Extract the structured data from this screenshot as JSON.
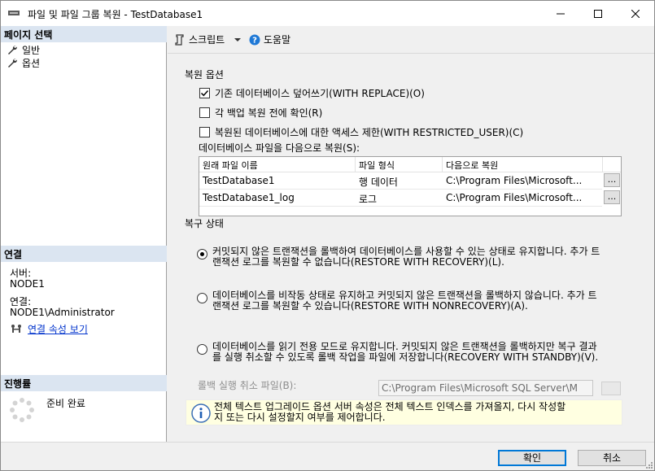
{
  "window": {
    "title": "파일 및 파일 그룹 복원 - TestDatabase1"
  },
  "left_pane": {
    "page_select_header": "페이지 선택",
    "pages": [
      {
        "label": "일반",
        "icon": "wrench-icon"
      },
      {
        "label": "옵션",
        "icon": "wrench-icon"
      }
    ],
    "connection_header": "연결",
    "server_label": "서버:",
    "server_value": "NODE1",
    "connection_label": "연결:",
    "connection_value": "NODE1\\Administrator",
    "view_connection_link": "연결 속성 보기",
    "progress_header": "진행률",
    "progress_status": "준비 완료"
  },
  "toolbar": {
    "script_label": "스크립트",
    "help_label": "도움말"
  },
  "restore_options": {
    "title": "복원 옵션",
    "options": [
      {
        "label": "기존 데이터베이스 덮어쓰기(WITH REPLACE)(O)",
        "checked": true
      },
      {
        "label": "각 백업 복원 전에 확인(R)",
        "checked": false
      },
      {
        "label": "복원된 데이터베이스에 대한 액세스 제한(WITH RESTRICTED_USER)(C)",
        "checked": false
      }
    ],
    "restore_files_as_label": "데이터베이스 파일을 다음으로 복원(S):",
    "table": {
      "headers": [
        "원래 파일 이름",
        "파일 형식",
        "다음으로 복원"
      ],
      "rows": [
        {
          "original": "TestDatabase1",
          "type": "행 데이터",
          "restore_as": "C:\\Program Files\\Microsoft..."
        },
        {
          "original": "TestDatabase1_log",
          "type": "로그",
          "restore_as": "C:\\Program Files\\Microsoft..."
        }
      ],
      "browse_label": "..."
    }
  },
  "recovery_state": {
    "title": "복구 상태",
    "options": [
      {
        "line1": "커밋되지 않은 트랜잭션을 롤백하여 데이터베이스를 사용할 수 있는 상태로 유지합니다. 추가 트",
        "line2": "랜잭션 로그를 복원할 수 없습니다(RESTORE WITH RECOVERY)(L).",
        "selected": true
      },
      {
        "line1": "데이터베이스를 비작동 상태로 유지하고 커밋되지 않은 트랜잭션을 롤백하지 않습니다. 추가 트",
        "line2": "랜잭션 로그를 복원할 수 있습니다(RESTORE WITH NONRECOVERY)(A).",
        "selected": false
      },
      {
        "line1": "데이터베이스를 읽기 전용 모드로 유지합니다. 커밋되지 않은 트랜잭션을 롤백하지만 복구 결과",
        "line2": "를 실행 취소할 수 있도록 롤백 작업을 파일에 저장합니다(RECOVERY WITH STANDBY)(V).",
        "selected": false
      }
    ],
    "rollback_file_label": "롤백 실행 취소 파일(B):",
    "rollback_file_value": "C:\\Program Files\\Microsoft SQL Server\\M",
    "browse_label": "...",
    "info_line1": "전체 텍스트 업그레이드 옵션 서버 속성은 전체 텍스트 인덱스를 가져올지, 다시 작성할",
    "info_line2": "지 또는 다시 설정할지 여부를 제어합니다."
  },
  "buttons": {
    "ok": "확인",
    "cancel": "취소"
  },
  "colors": {
    "accent": "#0078d7",
    "pane_header": "#dbe5f1",
    "info_background": "#ffffe1",
    "link": "#0033cc"
  }
}
